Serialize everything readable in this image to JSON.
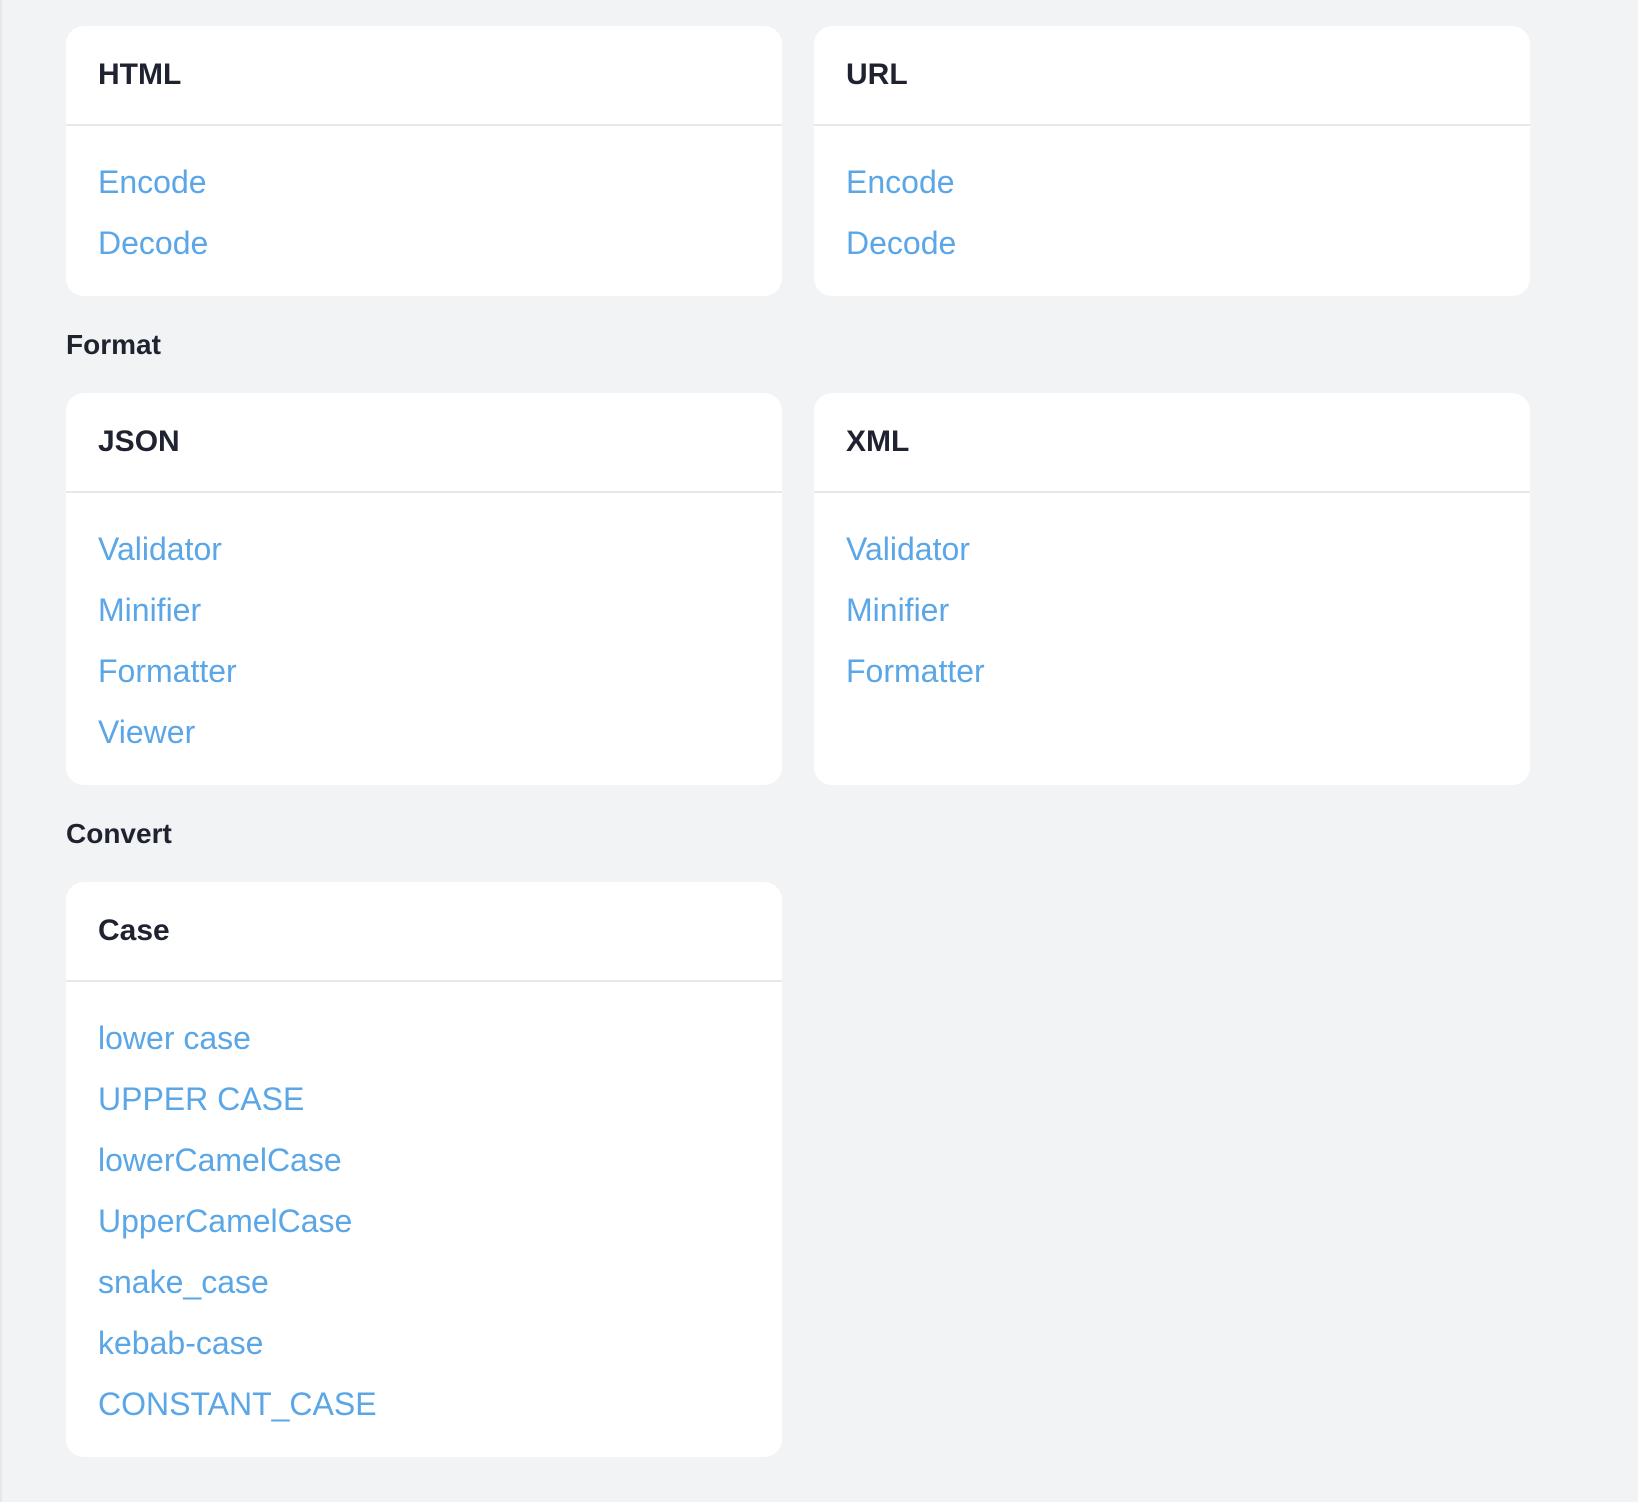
{
  "encode_section": {
    "cards": [
      {
        "title": "HTML",
        "links": [
          "Encode",
          "Decode"
        ]
      },
      {
        "title": "URL",
        "links": [
          "Encode",
          "Decode"
        ]
      }
    ]
  },
  "format_section": {
    "title": "Format",
    "cards": [
      {
        "title": "JSON",
        "links": [
          "Validator",
          "Minifier",
          "Formatter",
          "Viewer"
        ]
      },
      {
        "title": "XML",
        "links": [
          "Validator",
          "Minifier",
          "Formatter"
        ]
      }
    ]
  },
  "convert_section": {
    "title": "Convert",
    "cards": [
      {
        "title": "Case",
        "links": [
          "lower case",
          "UPPER CASE",
          "lowerCamelCase",
          "UpperCamelCase",
          "snake_case",
          "kebab-case",
          "CONSTANT_CASE"
        ]
      }
    ]
  },
  "colors": {
    "background": "#f2f3f5",
    "card": "#ffffff",
    "link": "#5aa6e6",
    "heading": "#1f2330",
    "divider": "#e7e8eb"
  }
}
